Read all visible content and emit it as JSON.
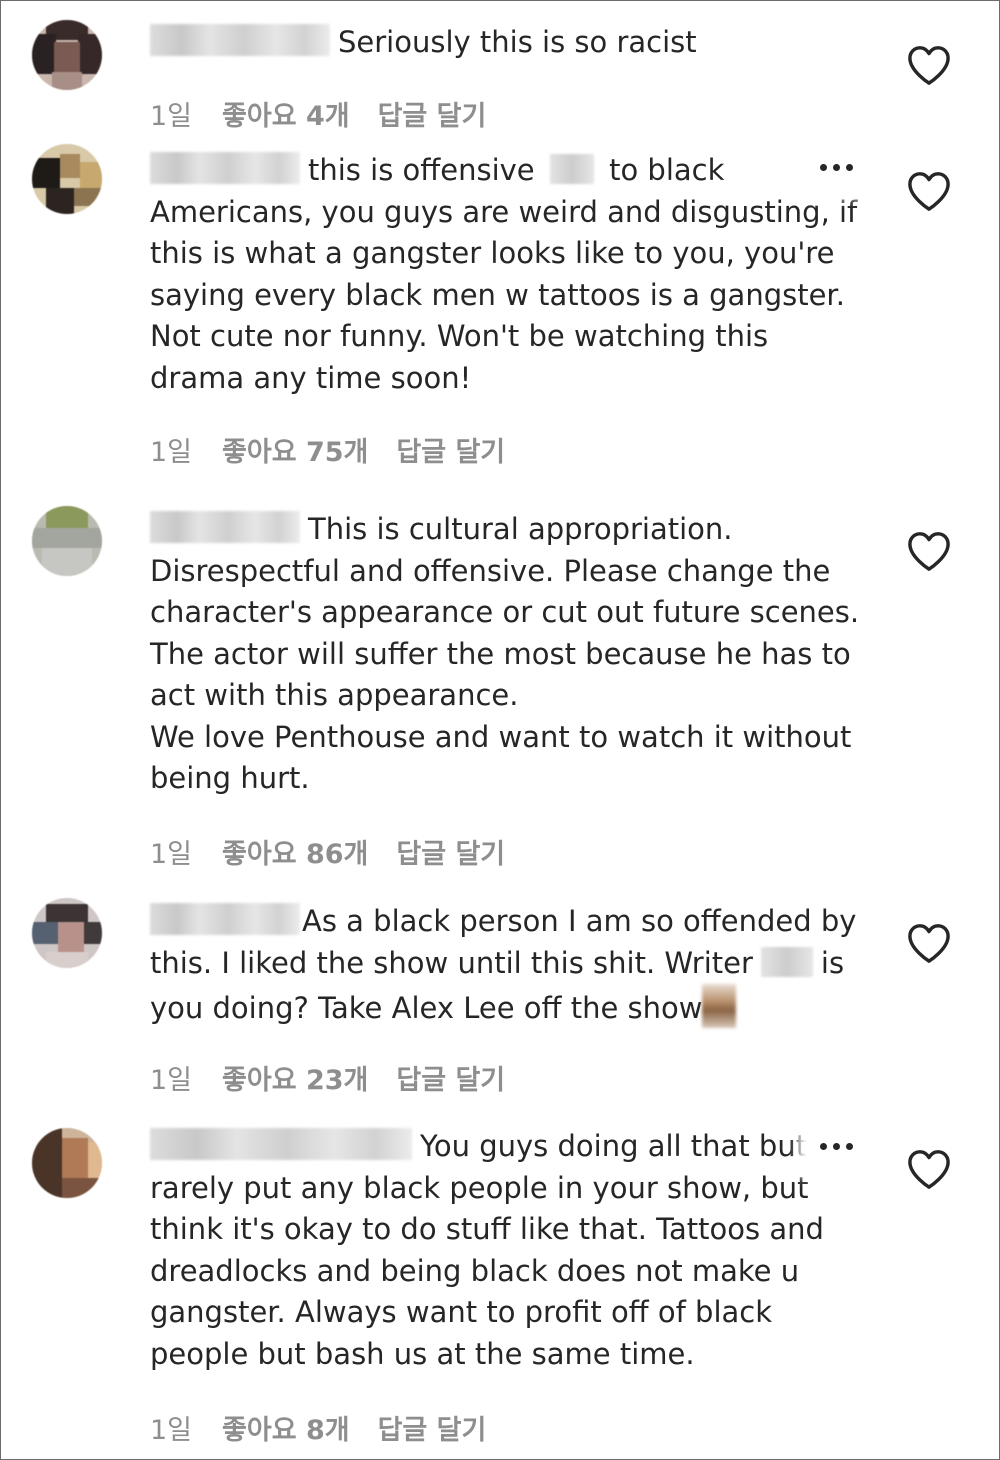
{
  "icons": {
    "like": "heart-outline-icon",
    "more": "more-options-icon"
  },
  "colors": {
    "text": "#262626",
    "meta": "#8e8e8e",
    "border": "#6b6b6b"
  },
  "comments": [
    {
      "text": "Seriously this is so racist",
      "time": "1일",
      "likes": "좋아요 4개",
      "reply": "답글 달기"
    },
    {
      "text_a": "this is offensive",
      "text_b": "to black\nAmericans, you guys are weird and disgusting, if\nthis is what a gangster looks like to you, you're\nsaying every black men w tattoos is a gangster.\nNot cute nor funny. Won't be watching this\ndrama any time soon!",
      "time": "1일",
      "likes": "좋아요 75개",
      "reply": "답글 달기"
    },
    {
      "text": "This is cultural appropriation.\nDisrespectful and offensive. Please change the\ncharacter's appearance or cut out future scenes.\nThe actor will suffer the most because he has to\nact with this appearance.\nWe love Penthouse and want to watch it without\nbeing hurt.",
      "time": "1일",
      "likes": "좋아요 86개",
      "reply": "답글 달기"
    },
    {
      "text_a": "As a black person I am so offended by\nthis. I liked the show until this shit. Writer",
      "text_b": "is\nyou doing? Take Alex Lee off the show",
      "time": "1일",
      "likes": "좋아요 23개",
      "reply": "답글 달기"
    },
    {
      "text": "You guys doing all that but\nrarely put any black people in your show, but\nthink it's okay to do stuff like that. Tattoos and\ndreadlocks and being black does not make u\ngangster. Always want to profit off of black\npeople but bash us at the same time.",
      "time": "1일",
      "likes": "좋아요 8개",
      "reply": "답글 달기"
    }
  ]
}
